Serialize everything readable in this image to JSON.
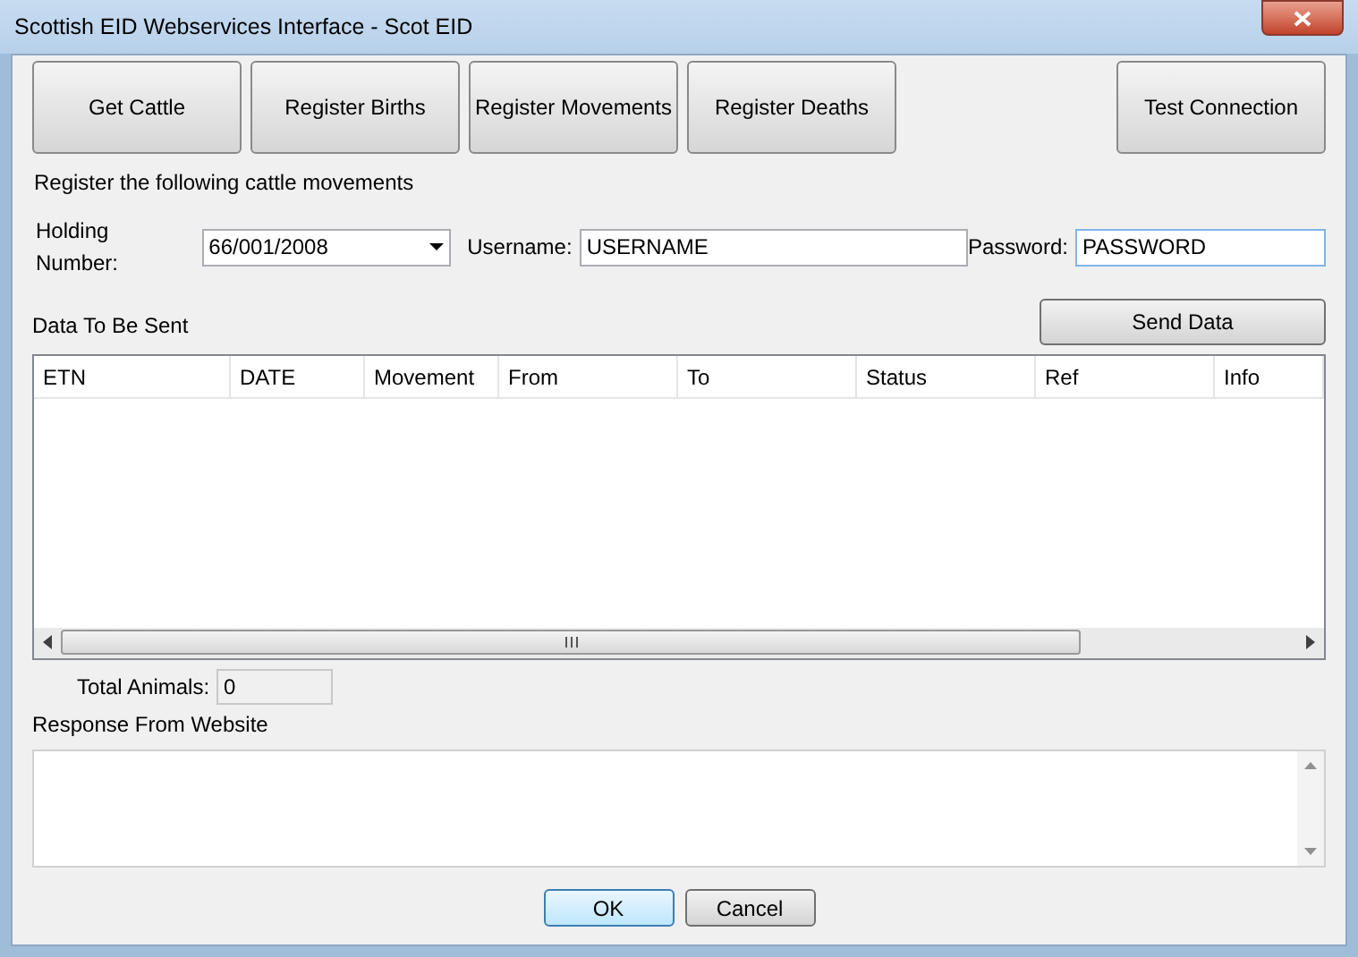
{
  "window": {
    "title": "Scottish EID Webservices Interface - Scot EID"
  },
  "toolbar": {
    "buttons": [
      "Get Cattle",
      "Register Births",
      "Register Movements",
      "Register Deaths"
    ],
    "right_button": "Test Connection"
  },
  "heading": "Register the following cattle movements",
  "holding": {
    "label": "Holding Number:",
    "value": "66/001/2008"
  },
  "username": {
    "label": "Username:",
    "value": "USERNAME"
  },
  "password": {
    "label": "Password:",
    "value": "PASSWORD"
  },
  "data_label": "Data To Be Sent",
  "send_button": "Send Data",
  "table": {
    "columns": [
      "ETN",
      "DATE",
      "Movement",
      "From",
      "To",
      "Status",
      "Ref",
      "Info"
    ]
  },
  "total": {
    "label": "Total Animals:",
    "value": "0"
  },
  "response_label": "Response From Website",
  "buttons": [
    {
      "label": "OK",
      "default": true
    },
    {
      "label": "Cancel",
      "default": false
    }
  ]
}
